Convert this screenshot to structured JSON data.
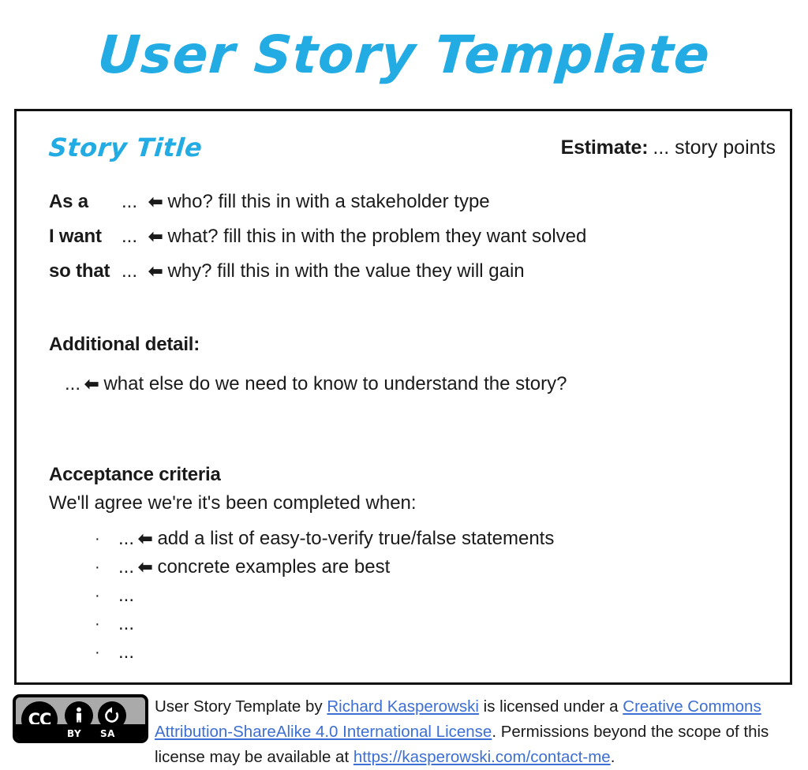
{
  "page": {
    "title": "User Story Template",
    "accent_color": "#23ace3",
    "border_color": "#111111",
    "link_color": "#3d6fd4",
    "arrow_glyph": "⬅"
  },
  "card": {
    "story_title": "Story Title",
    "estimate": {
      "label": "Estimate:",
      "value": "... story points"
    },
    "role_rows": [
      {
        "label": "As a",
        "dots": "...",
        "arrow": "⬅",
        "hint": "who? fill this in with a stakeholder type"
      },
      {
        "label": "I want",
        "dots": "...",
        "arrow": "⬅",
        "hint": "what? fill this in with the problem they want solved"
      },
      {
        "label": "so that",
        "dots": "...",
        "arrow": "⬅",
        "hint": "why? fill this in with the value they will gain"
      }
    ],
    "additional_detail": {
      "heading": "Additional detail:",
      "dots": "...",
      "arrow": "⬅",
      "hint": "what else do we need to know to understand the story?"
    },
    "acceptance": {
      "heading": "Acceptance criteria",
      "subheading": "We'll agree we're it's been completed when:",
      "items": [
        {
          "bullet": "·",
          "dots": "...",
          "arrow": "⬅",
          "hint": "add a list of easy-to-verify true/false statements"
        },
        {
          "bullet": "·",
          "dots": "...",
          "arrow": "⬅",
          "hint": "concrete examples are best"
        },
        {
          "bullet": "·",
          "dots": "...",
          "arrow": "",
          "hint": ""
        },
        {
          "bullet": "·",
          "dots": "...",
          "arrow": "",
          "hint": ""
        },
        {
          "bullet": "·",
          "dots": "...",
          "arrow": "",
          "hint": ""
        }
      ]
    }
  },
  "footer": {
    "badge": {
      "cc": "CC",
      "by": "BY",
      "sa": "SA"
    },
    "license": {
      "part1": "User Story Template by ",
      "author_link": "Richard Kasperowski",
      "part2": " is licensed under a ",
      "license_link": "Creative Commons Attribution-ShareAlike 4.0 International License",
      "part3": ". Permissions beyond the scope of this license may be available at ",
      "contact_link": "https://kasperowski.com/contact-me",
      "part4": "."
    }
  }
}
